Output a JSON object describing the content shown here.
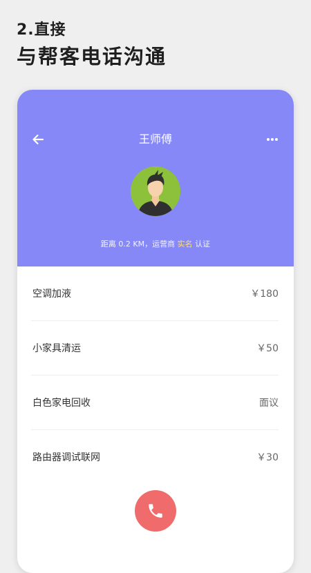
{
  "caption": {
    "step": "2.直接",
    "headline": "与帮客电话沟通"
  },
  "header": {
    "title": "王师傅",
    "background": "#8688f7",
    "info": {
      "distance": "距离 0.2 KM，运营商 ",
      "verified": "实名",
      "certified": " 认证"
    }
  },
  "services": [
    {
      "name": "空调加液",
      "price": "￥180"
    },
    {
      "name": "小家具清运",
      "price": "￥50"
    },
    {
      "name": "白色家电回收",
      "price": "面议"
    },
    {
      "name": "路由器调试联网",
      "price": "￥30"
    }
  ],
  "icons": {
    "back": "arrow-left-icon",
    "more": "more-dots-icon",
    "call": "phone-icon"
  },
  "colors": {
    "accent": "#8688f7",
    "call": "#f06b6b",
    "verified_highlight": "#ffe067"
  }
}
